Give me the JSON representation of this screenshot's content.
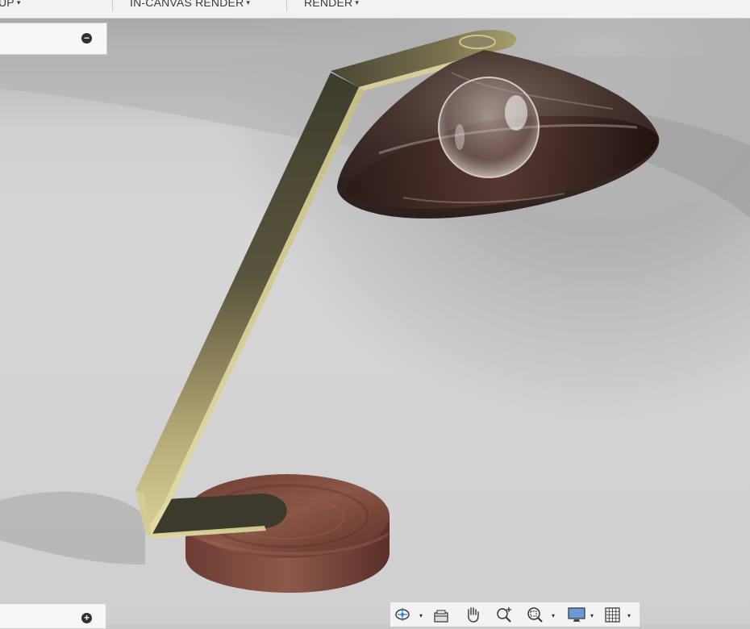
{
  "toolbar": {
    "items": [
      {
        "label": "UP"
      },
      {
        "label": "IN-CANVAS RENDER"
      },
      {
        "label": "RENDER"
      }
    ],
    "caret": "▾"
  },
  "browser_panels": {
    "top_toggle": "−",
    "bottom_toggle": "+"
  },
  "navbar": {
    "icons": [
      "orbit-icon",
      "look-at-icon",
      "pan-icon",
      "zoom-icon",
      "zoom-window-icon",
      "display-settings-icon",
      "grid-icon"
    ],
    "caret": "▾"
  },
  "colors": {
    "toolbar_bg": "#f2f2f2",
    "viewport_bg": "#d0d0d0",
    "brass": "#c9bf80",
    "walnut": "#7a4a3c",
    "shade": "#3a2622"
  }
}
